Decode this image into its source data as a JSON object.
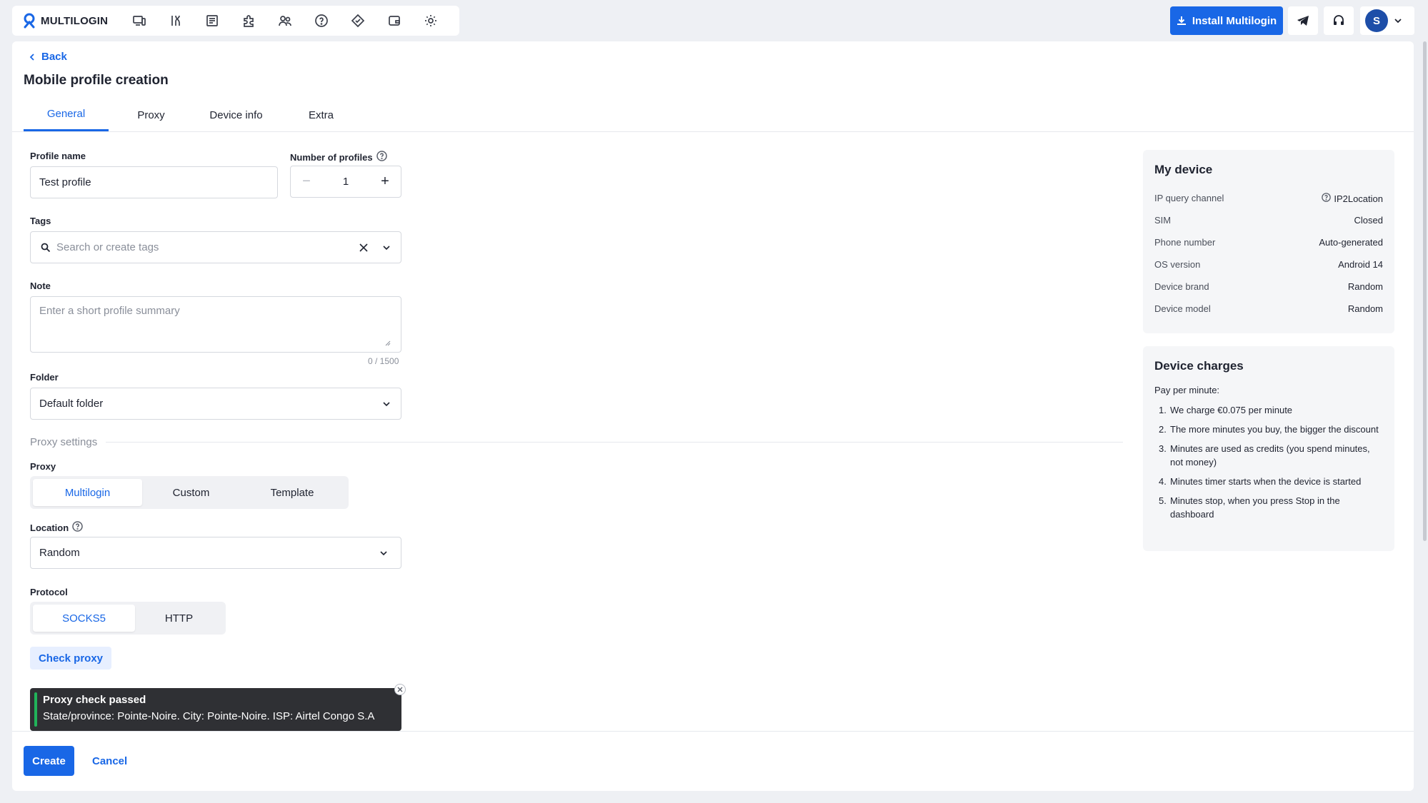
{
  "app": {
    "logo_text": "MULTILOGIN",
    "install_label": "Install Multilogin",
    "avatar_initial": "S"
  },
  "nav": {
    "icons": [
      "devices-icon",
      "automation-icon",
      "profiles-list-icon",
      "extensions-icon",
      "team-icon",
      "help-icon",
      "proxy-icon",
      "wallet-icon",
      "settings-icon"
    ]
  },
  "page": {
    "back_label": "Back",
    "title": "Mobile profile creation"
  },
  "tabs": [
    {
      "label": "General",
      "active": true
    },
    {
      "label": "Proxy",
      "active": false
    },
    {
      "label": "Device info",
      "active": false
    },
    {
      "label": "Extra",
      "active": false
    }
  ],
  "form": {
    "profile_name_label": "Profile name",
    "profile_name_value": "Test profile",
    "num_profiles_label": "Number of profiles",
    "num_profiles_value": "1",
    "tags_label": "Tags",
    "tags_placeholder": "Search or create tags",
    "note_label": "Note",
    "note_placeholder": "Enter a short profile summary",
    "note_counter": "0 / 1500",
    "folder_label": "Folder",
    "folder_value": "Default folder",
    "proxy_section": "Proxy settings",
    "proxy_label": "Proxy",
    "proxy_options": [
      "Multilogin",
      "Custom",
      "Template"
    ],
    "location_label": "Location",
    "location_value": "Random",
    "protocol_label": "Protocol",
    "protocol_options": [
      "SOCKS5",
      "HTTP"
    ],
    "check_proxy_label": "Check proxy"
  },
  "toast": {
    "title": "Proxy check passed",
    "message": "State/province: Pointe-Noire. City: Pointe-Noire. ISP: Airtel Congo S.A"
  },
  "actions": {
    "create_label": "Create",
    "cancel_label": "Cancel"
  },
  "my_device": {
    "title": "My device",
    "rows": [
      {
        "key": "IP query channel",
        "value": "IP2Location"
      },
      {
        "key": "SIM",
        "value": "Closed"
      },
      {
        "key": "Phone number",
        "value": "Auto-generated"
      },
      {
        "key": "OS version",
        "value": "Android 14"
      },
      {
        "key": "Device brand",
        "value": "Random"
      },
      {
        "key": "Device model",
        "value": "Random"
      }
    ]
  },
  "charges": {
    "title": "Device charges",
    "subtitle": "Pay per minute:",
    "items": [
      "We charge €0.075 per minute",
      "The more minutes you buy, the bigger the discount",
      "Minutes are used as credits (you spend minutes, not money)",
      "Minutes timer starts when the device is started",
      "Minutes stop, when you press Stop in the dashboard"
    ]
  },
  "colors": {
    "accent": "#1967e6",
    "success": "#21b35a",
    "toast_bg": "#2f3034"
  }
}
